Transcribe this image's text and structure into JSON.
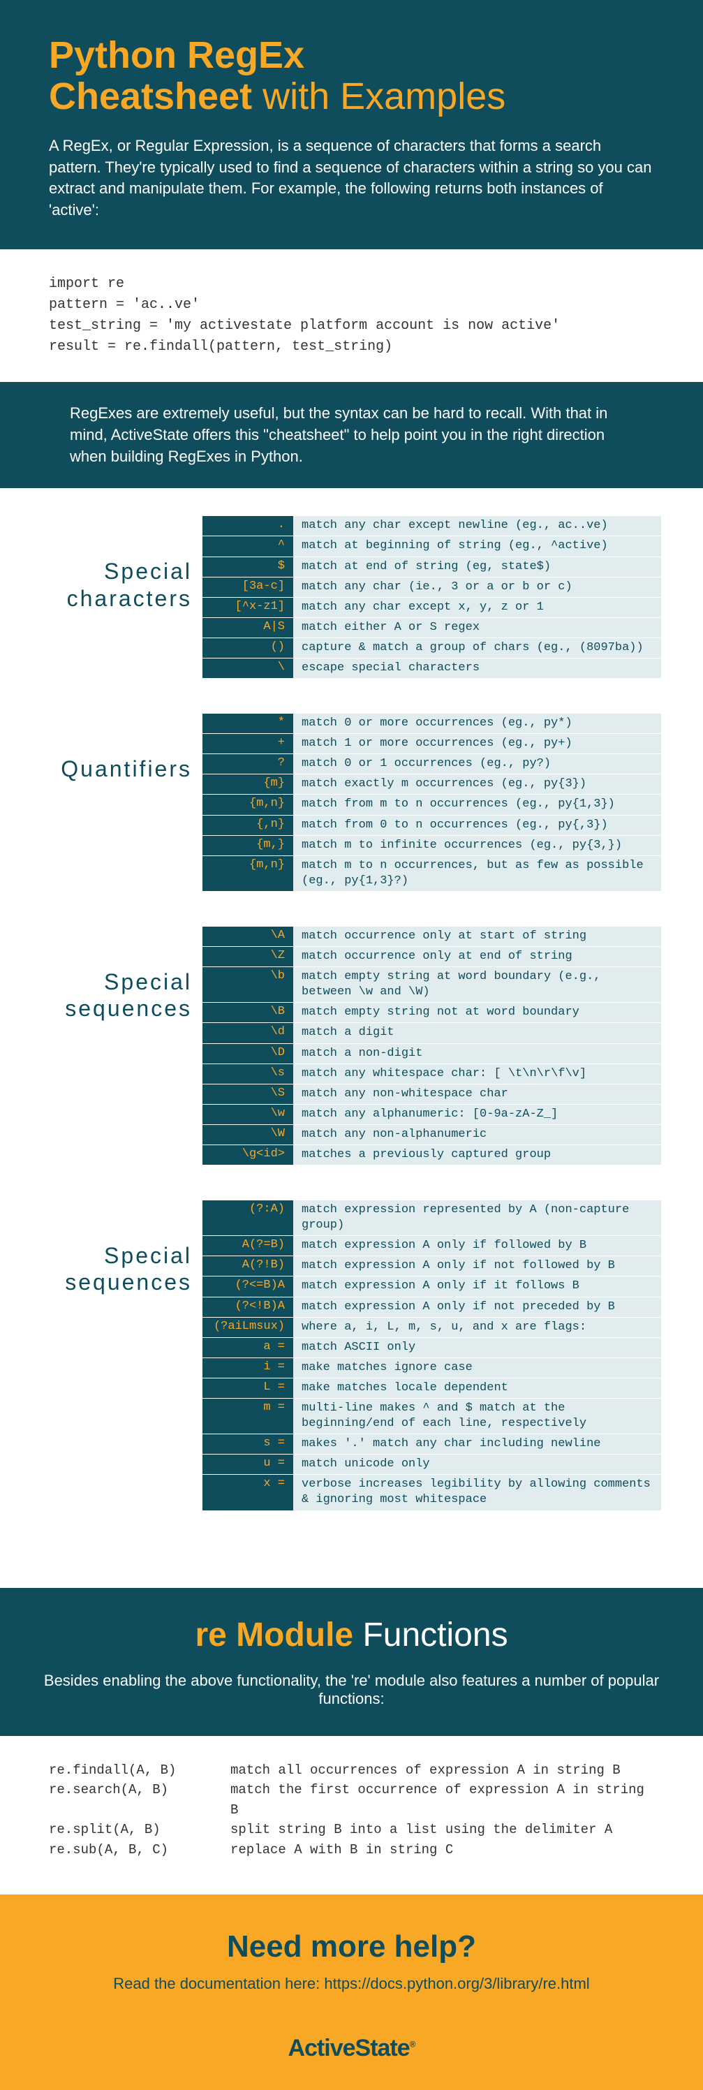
{
  "title_line1": "Python RegEx",
  "title_bold": "Cheatsheet",
  "title_thin": " with Examples",
  "intro": "A RegEx, or Regular Expression, is a sequence of characters that forms a search pattern. They're typically used to find a sequence of characters within a string so you can extract and manipulate them. For example, the following returns both instances of 'active':",
  "code": "import re\npattern = 'ac..ve'\ntest_string = 'my activestate platform account is now active'\nresult = re.findall(pattern, test_string)",
  "note": "RegExes are extremely useful, but the syntax can be hard to recall. With that in mind, ActiveState offers this \"cheatsheet\" to help point you in the right direction when building RegExes in Python.",
  "sections": [
    {
      "label": "Special characters",
      "rows": [
        {
          "sym": ".",
          "desc": "match any char except newline (eg., ac..ve)"
        },
        {
          "sym": "^",
          "desc": "match at beginning of string (eg., ^active)"
        },
        {
          "sym": "$",
          "desc": "match at end of string (eg, state$)"
        },
        {
          "sym": "[3a-c]",
          "desc": "match any char (ie., 3 or a or b or c)"
        },
        {
          "sym": "[^x-z1]",
          "desc": "match any char except x, y, z or 1"
        },
        {
          "sym": "A|S",
          "desc": "match either A or S regex"
        },
        {
          "sym": "()",
          "desc": "capture & match a group of chars (eg., (8097ba))"
        },
        {
          "sym": "\\",
          "desc": "escape special characters"
        }
      ]
    },
    {
      "label": "Quantifiers",
      "rows": [
        {
          "sym": "*",
          "desc": "match 0 or more occurrences (eg., py*)"
        },
        {
          "sym": "+",
          "desc": "match 1 or more occurrences (eg., py+)"
        },
        {
          "sym": "?",
          "desc": "match 0 or 1 occurrences (eg., py?)"
        },
        {
          "sym": "{m}",
          "desc": "match exactly m occurrences (eg., py{3})"
        },
        {
          "sym": "{m,n}",
          "desc": "match from m to n occurrences (eg., py{1,3})"
        },
        {
          "sym": "{,n}",
          "desc": "match from 0 to n occurrences (eg., py{,3})"
        },
        {
          "sym": "{m,}",
          "desc": "match m to infinite occurrences (eg., py{3,})"
        },
        {
          "sym": "{m,n}",
          "desc": "match m to n occurrences, but as few as possible (eg., py{1,3}?)"
        }
      ]
    },
    {
      "label": "Special sequences",
      "rows": [
        {
          "sym": "\\A",
          "desc": "match occurrence only at start of string"
        },
        {
          "sym": "\\Z",
          "desc": "match occurrence only at end of string"
        },
        {
          "sym": "\\b",
          "desc": "match empty string at word boundary (e.g., between \\w and \\W)"
        },
        {
          "sym": "\\B",
          "desc": "match empty string not at word boundary"
        },
        {
          "sym": "\\d",
          "desc": "match a digit"
        },
        {
          "sym": "\\D",
          "desc": "match a non-digit"
        },
        {
          "sym": "\\s",
          "desc": "match any whitespace char: [ \\t\\n\\r\\f\\v]"
        },
        {
          "sym": "\\S",
          "desc": "match any non-whitespace char"
        },
        {
          "sym": "\\w",
          "desc": "match any alphanumeric: [0-9a-zA-Z_]"
        },
        {
          "sym": "\\W",
          "desc": "match any non-alphanumeric"
        },
        {
          "sym": "\\g<id>",
          "desc": "matches a previously captured group"
        }
      ]
    },
    {
      "label": "Special sequences",
      "rows": [
        {
          "sym": "(?:A)",
          "desc": "match expression represented by A (non-capture group)"
        },
        {
          "sym": "A(?=B)",
          "desc": "match expression A only if followed by B"
        },
        {
          "sym": "A(?!B)",
          "desc": " match expression A only if not followed by B"
        },
        {
          "sym": "(?<=B)A",
          "desc": " match expression A only if it follows B"
        },
        {
          "sym": "(?<!B)A",
          "desc": "match expression A only if not preceded by B"
        },
        {
          "sym": "(?aiLmsux)",
          "desc": "where a, i, L, m, s, u, and x are flags:"
        },
        {
          "sym": "a =",
          "desc": "match ASCII only"
        },
        {
          "sym": "i =",
          "desc": "make matches ignore case"
        },
        {
          "sym": "L =",
          "desc": "make matches locale dependent"
        },
        {
          "sym": "m =",
          "desc": "multi-line makes ^ and $ match at the beginning/end of each line, respectively"
        },
        {
          "sym": "s =",
          "desc": "makes '.' match any char including newline"
        },
        {
          "sym": "u =",
          "desc": "match unicode only"
        },
        {
          "sym": "x =",
          "desc": "verbose increases legibility by allowing comments & ignoring most whitespace"
        }
      ]
    }
  ],
  "module_title_bold": "re Module",
  "module_title_thin": " Functions",
  "module_intro": "Besides enabling the above functionality, the 're' module also features a number of popular functions:",
  "functions": [
    {
      "name": "re.findall(A, B)",
      "desc": "match all occurrences of expression A in string B"
    },
    {
      "name": "re.search(A, B)",
      "desc": "match the first occurrence of expression A in string B"
    },
    {
      "name": "re.split(A, B)",
      "desc": "split string B into a list using the delimiter A"
    },
    {
      "name": "re.sub(A, B, C)",
      "desc": "replace A with B in string C"
    }
  ],
  "footer_title": "Need more help?",
  "footer_text": "Read the documentation here: https://docs.python.org/3/library/re.html",
  "brand": "ActiveState"
}
